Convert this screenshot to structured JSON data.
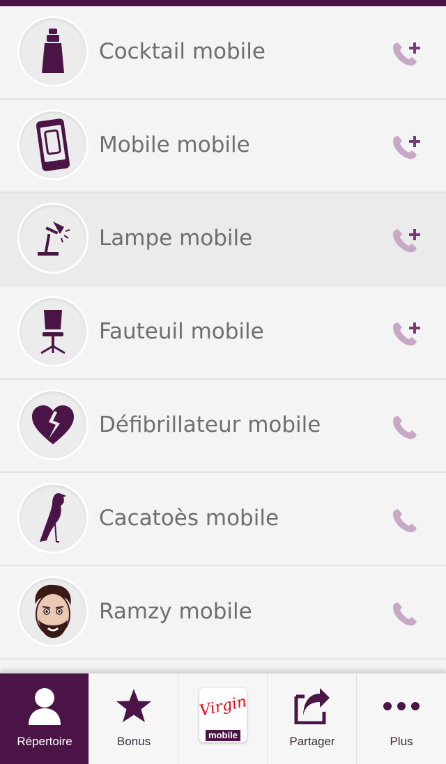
{
  "contacts": [
    {
      "name": "Cocktail mobile",
      "icon": "cocktail-shaker-icon",
      "action": "add-call-icon"
    },
    {
      "name": "Mobile mobile",
      "icon": "smartphone-icon",
      "action": "add-call-icon"
    },
    {
      "name": "Lampe mobile",
      "icon": "desk-lamp-icon",
      "action": "add-call-icon"
    },
    {
      "name": "Fauteuil mobile",
      "icon": "office-chair-icon",
      "action": "add-call-icon"
    },
    {
      "name": "Défibrillateur mobile",
      "icon": "broken-heart-icon",
      "action": "call-icon"
    },
    {
      "name": "Cacatoès mobile",
      "icon": "bird-icon",
      "action": "call-icon"
    },
    {
      "name": "Ramzy mobile",
      "icon": "ramzy-face-avatar",
      "action": "call-icon"
    }
  ],
  "tabs": [
    {
      "label": "Répertoire",
      "icon": "person-icon",
      "active": true
    },
    {
      "label": "Bonus",
      "icon": "star-icon"
    },
    {
      "label": "",
      "icon": "virgin-mobile-logo",
      "logo_text": "Virgin",
      "logo_sub": "mobile"
    },
    {
      "label": "Partager",
      "icon": "share-icon"
    },
    {
      "label": "Plus",
      "icon": "more-dots-icon"
    }
  ],
  "colors": {
    "accent": "#4a1546",
    "call_icon": "#c7a9c6",
    "call_plus": "#7a3a78"
  }
}
